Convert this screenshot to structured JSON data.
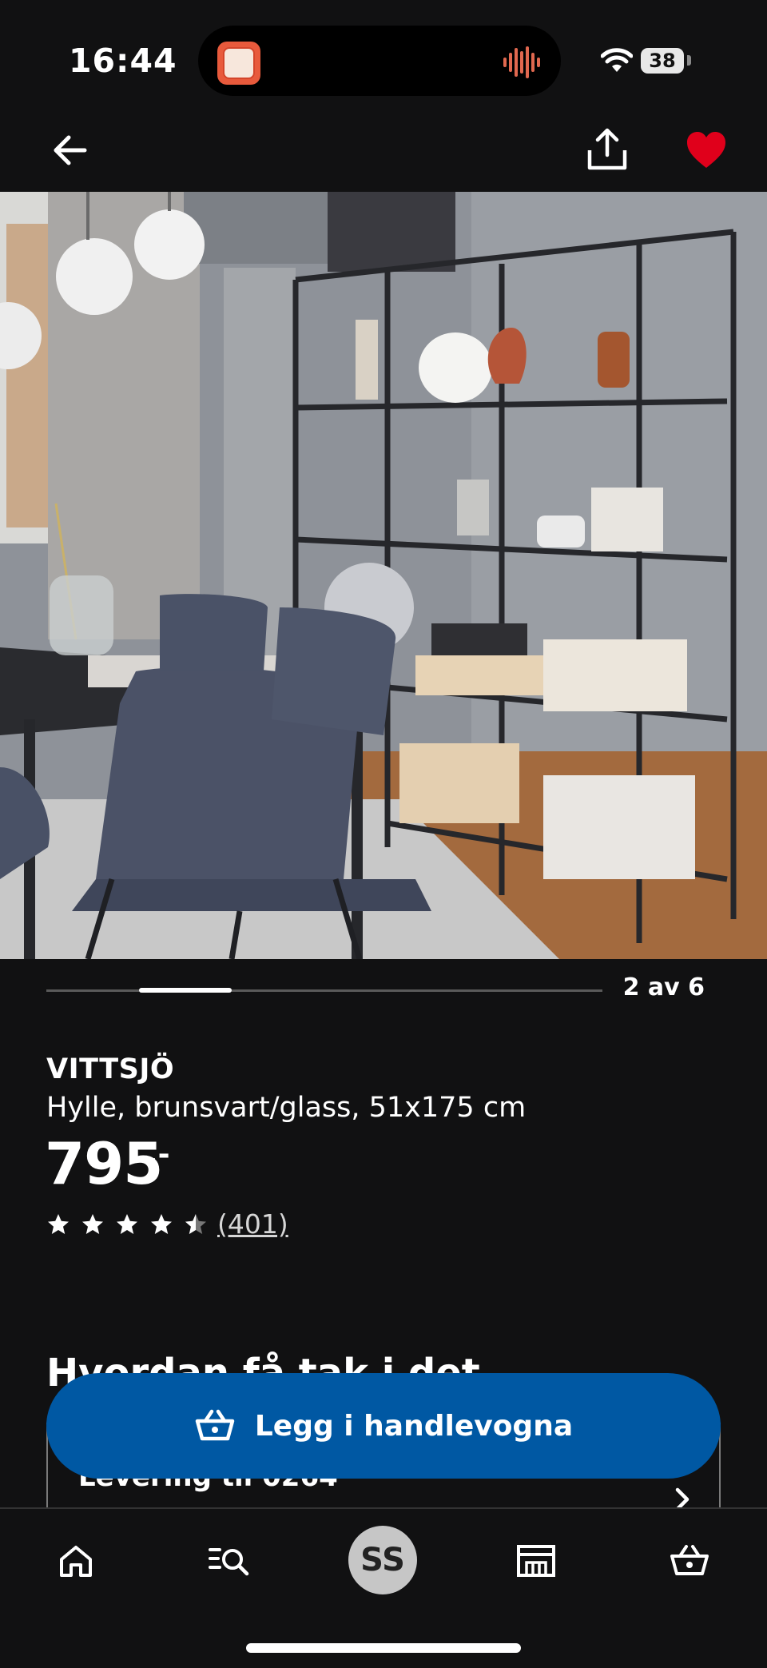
{
  "status_bar": {
    "time": "16:44",
    "battery": "38"
  },
  "header": {
    "favorite_active": true
  },
  "gallery": {
    "counter": "2 av 6",
    "current_index": 2,
    "total": 6
  },
  "product": {
    "name": "VITTSJÖ",
    "description": "Hylle, brunsvart/glass, 51x175 cm",
    "price": "795",
    "price_suffix": ",-",
    "rating": 4.5,
    "reviews": "(401)"
  },
  "availability": {
    "title": "Hvordan få tak i det",
    "delivery_label": "Levering til 0264"
  },
  "cta": {
    "add_to_cart": "Legg i handlevogna"
  },
  "tabbar": {
    "avatar_initials": "SS"
  },
  "colors": {
    "accent": "#0058a3",
    "favorite": "#e0001b",
    "background": "#111112"
  }
}
